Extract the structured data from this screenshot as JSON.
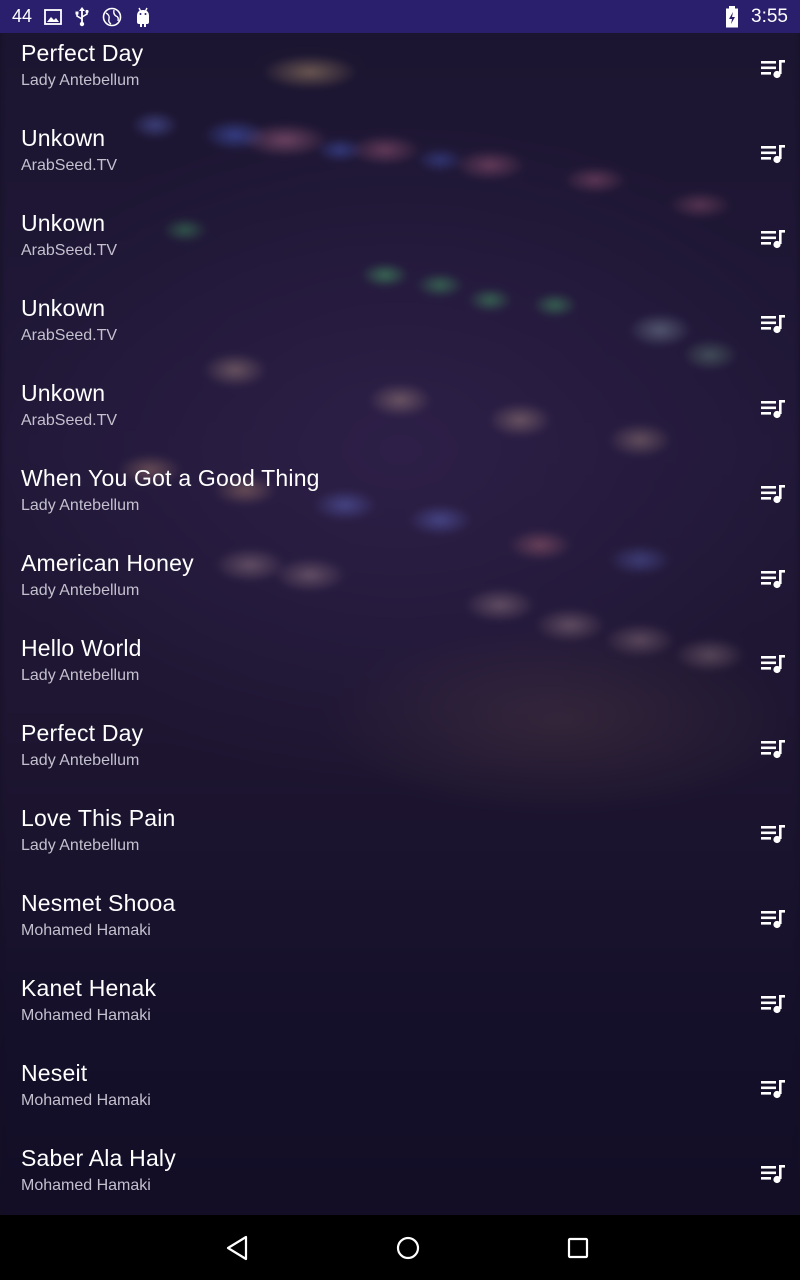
{
  "status_bar": {
    "notification_count": "44",
    "time": "3:55",
    "icons": [
      "image-icon",
      "usb-icon",
      "globe-icon",
      "android-icon",
      "battery-charging-icon"
    ]
  },
  "songs": [
    {
      "title": "Perfect Day",
      "artist": "Lady Antebellum"
    },
    {
      "title": "Unkown",
      "artist": "ArabSeed.TV"
    },
    {
      "title": "Unkown",
      "artist": "ArabSeed.TV"
    },
    {
      "title": "Unkown",
      "artist": "ArabSeed.TV"
    },
    {
      "title": "Unkown",
      "artist": "ArabSeed.TV"
    },
    {
      "title": "When You Got a Good Thing",
      "artist": "Lady Antebellum"
    },
    {
      "title": "American Honey",
      "artist": "Lady Antebellum"
    },
    {
      "title": "Hello World",
      "artist": "Lady Antebellum"
    },
    {
      "title": "Perfect Day",
      "artist": "Lady Antebellum"
    },
    {
      "title": "Love This Pain",
      "artist": "Lady Antebellum"
    },
    {
      "title": "Nesmet Shooa",
      "artist": "Mohamed Hamaki"
    },
    {
      "title": "Kanet Henak",
      "artist": "Mohamed Hamaki"
    },
    {
      "title": "Neseit",
      "artist": "Mohamed Hamaki"
    },
    {
      "title": "Saber Ala Haly",
      "artist": "Mohamed Hamaki"
    }
  ],
  "row_action_icon": "queue-music-icon",
  "nav_bar": {
    "buttons": [
      "back-icon",
      "home-icon",
      "recents-icon"
    ]
  },
  "colors": {
    "status_bar": "#2a1f6d",
    "title_text": "#ffffff",
    "subtitle_text": "#c4c0ce",
    "nav_bar": "#000000"
  }
}
